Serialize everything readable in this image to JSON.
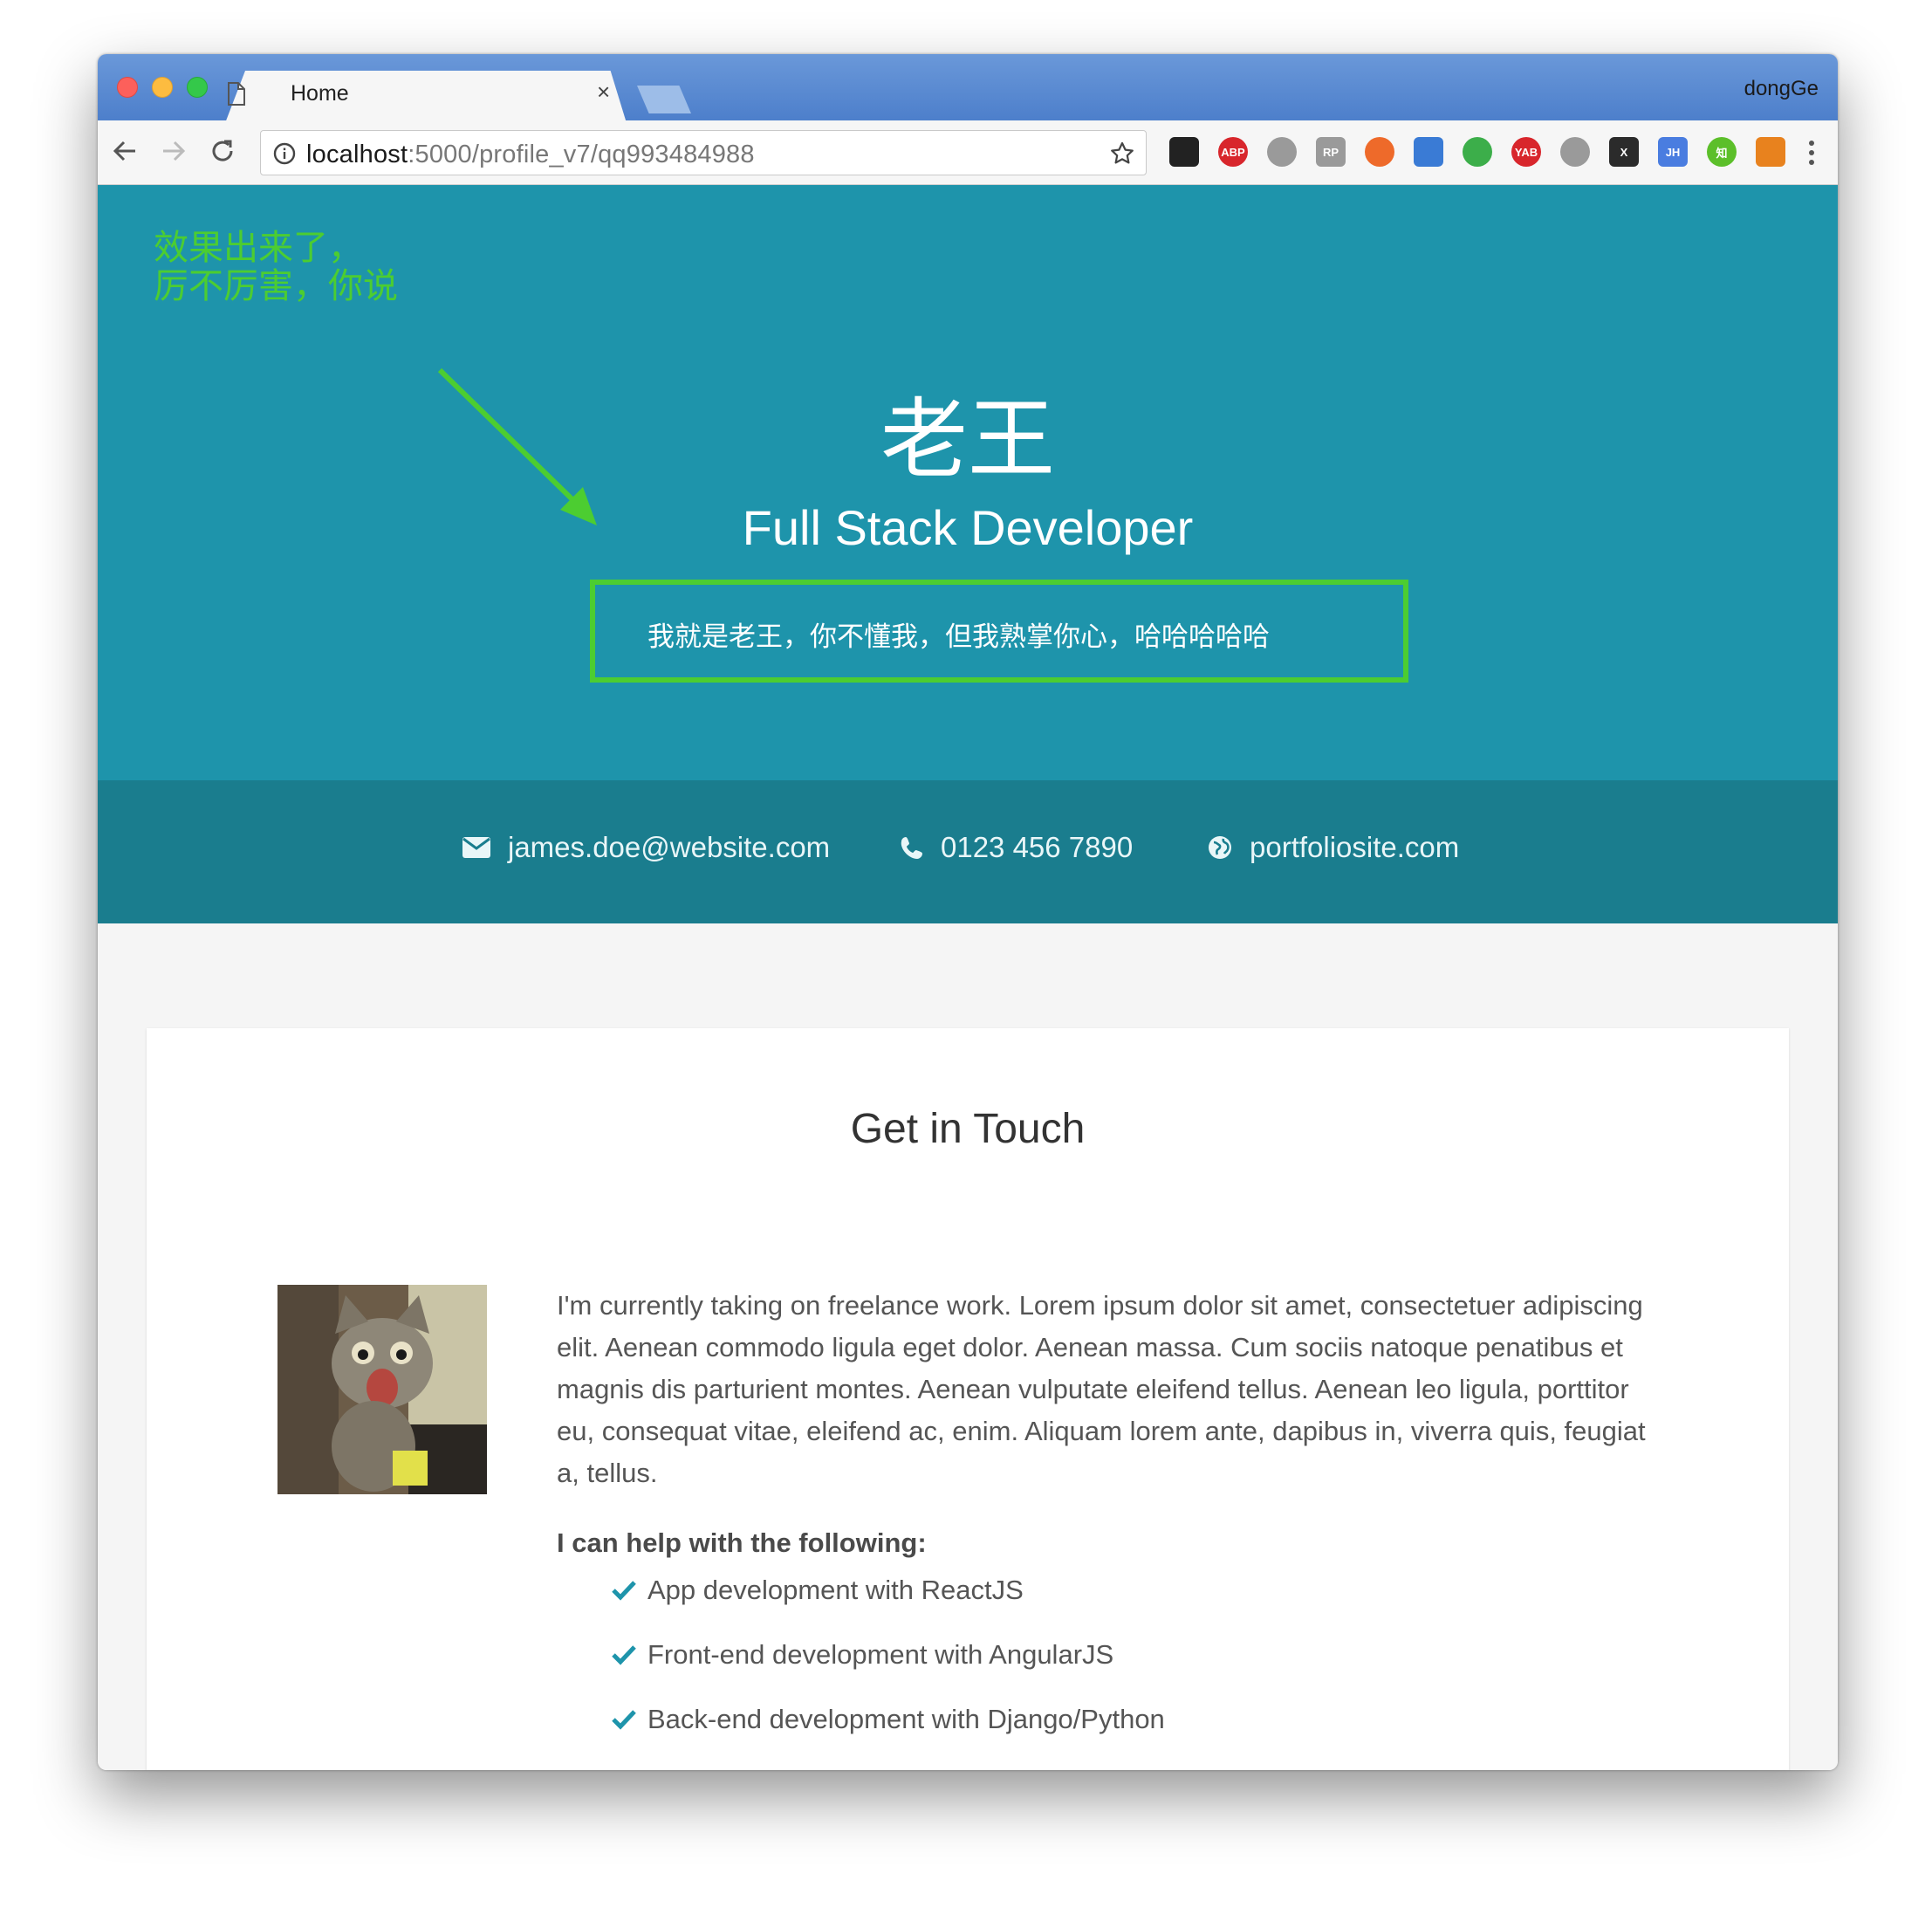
{
  "browser": {
    "tab_title": "Home",
    "tab_close": "×",
    "profile_name": "dongGe",
    "url_host": "localhost",
    "url_path": ":5000/profile_v7/qq993484988",
    "extensions": [
      {
        "name": "qr-code",
        "label": "",
        "color": "#222222"
      },
      {
        "name": "adblock-plus",
        "label": "ABP",
        "color": "#d8262c"
      },
      {
        "name": "globe",
        "label": "",
        "color": "#9a9a9a"
      },
      {
        "name": "rp",
        "label": "RP",
        "color": "#9a9a9a"
      },
      {
        "name": "lifebuoy",
        "label": "",
        "color": "#ee6a2a"
      },
      {
        "name": "wheel",
        "label": "",
        "color": "#3a7bd5"
      },
      {
        "name": "shield",
        "label": "",
        "color": "#3cae4a"
      },
      {
        "name": "yab",
        "label": "YAB",
        "color": "#d8262c"
      },
      {
        "name": "sphere",
        "label": "",
        "color": "#9a9a9a"
      },
      {
        "name": "x-ext",
        "label": "X",
        "color": "#2b2b2b"
      },
      {
        "name": "jh",
        "label": "JH",
        "color": "#4a7de0"
      },
      {
        "name": "zhi",
        "label": "知",
        "color": "#5cbf2a"
      },
      {
        "name": "fox",
        "label": "",
        "color": "#e8821e"
      }
    ]
  },
  "annotation": {
    "note": "效果出来了，\n厉不厉害，你说",
    "color": "#4ccd31"
  },
  "hero": {
    "name": "老王",
    "role": "Full Stack Developer",
    "intro": "我就是老王，你不懂我，但我熟掌你心，哈哈哈哈哈",
    "bg_color": "#1e94ab"
  },
  "contact": {
    "email": "james.doe@website.com",
    "phone": "0123 456 7890",
    "website": "portfoliosite.com",
    "bg_color": "#1a7d8e"
  },
  "card": {
    "title": "Get in Touch",
    "about": "I'm currently taking on freelance work. Lorem ipsum dolor sit amet, consectetuer adipiscing elit. Aenean commodo ligula eget dolor. Aenean massa. Cum sociis natoque penatibus et magnis dis parturient montes. Aenean vulputate eleifend tellus. Aenean leo ligula, porttitor eu, consequat vitae, eleifend ac, enim. Aliquam lorem ante, dapibus in, viverra quis, feugiat a, tellus.",
    "help_heading": "I can help with the following:",
    "skills": [
      "App development with ReactJS",
      "Front-end development with AngularJS",
      "Back-end development with Django/Python"
    ],
    "check_color": "#1e94ab"
  }
}
